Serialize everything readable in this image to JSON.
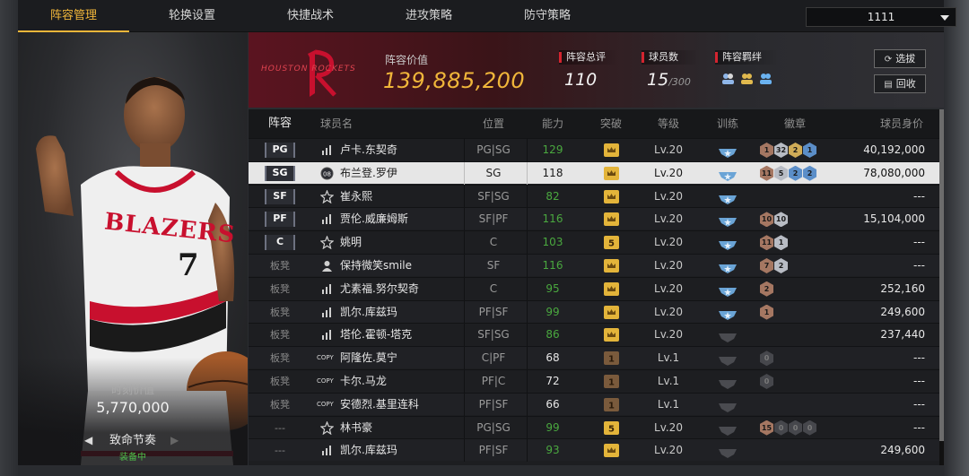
{
  "tabs": [
    {
      "label": "阵容管理",
      "active": true
    },
    {
      "label": "轮换设置",
      "active": false
    },
    {
      "label": "快捷战术",
      "active": false
    },
    {
      "label": "进攻策略",
      "active": false
    },
    {
      "label": "防守策略",
      "active": false
    }
  ],
  "team_select": {
    "value": "1111"
  },
  "card": {
    "value_label": "时刻价值",
    "value": "5,770,000",
    "skill": "致命节奏",
    "equipped": "装备中",
    "jersey_text": "BLAZERS",
    "jersey_number": "7"
  },
  "summary": {
    "logo_text": "HOUSTON ROCKETS",
    "value_label": "阵容价值",
    "value": "139,885,200",
    "rating_label": "阵容总评",
    "rating": "110",
    "count_label": "球员数",
    "count": "15",
    "count_max": "/300",
    "chem_label": "阵容羁绊",
    "select_btn": "选拔",
    "recycle_btn": "回收"
  },
  "columns": [
    "阵容",
    "球员名",
    "位置",
    "能力",
    "突破",
    "等级",
    "训练",
    "徽章",
    "球员身价"
  ],
  "rows": [
    {
      "slot": "PG",
      "name": "卢卡.东契奇",
      "icon": "bars",
      "pos": "PG|SG",
      "ability": "129",
      "green": true,
      "break": "crown",
      "level": "Lv.20",
      "train": "star",
      "badges": [
        [
          "b-bronze",
          "1"
        ],
        [
          "b-silver",
          "32"
        ],
        [
          "b-gold",
          "2"
        ],
        [
          "b-blue",
          "1"
        ]
      ],
      "value": "40,192,000"
    },
    {
      "slot": "SG",
      "name": "布兰登.罗伊",
      "icon": "badge",
      "pos": "SG",
      "ability": "118",
      "green": false,
      "break": "crown",
      "level": "Lv.20",
      "train": "star",
      "badges": [
        [
          "b-bronze",
          "11"
        ],
        [
          "b-silver",
          "5"
        ],
        [
          "b-blue",
          "2"
        ],
        [
          "b-blue",
          "2"
        ]
      ],
      "value": "78,080,000",
      "selected": true
    },
    {
      "slot": "SF",
      "name": "崔永熙",
      "icon": "star",
      "pos": "SF|SG",
      "ability": "82",
      "green": true,
      "break": "crown",
      "level": "Lv.20",
      "train": "star",
      "badges": [],
      "value": "---"
    },
    {
      "slot": "PF",
      "name": "贾伦.威廉姆斯",
      "icon": "bars",
      "pos": "SF|PF",
      "ability": "116",
      "green": true,
      "break": "crown",
      "level": "Lv.20",
      "train": "star",
      "badges": [
        [
          "b-bronze",
          "10"
        ],
        [
          "b-silver",
          "10"
        ]
      ],
      "value": "15,104,000"
    },
    {
      "slot": "C",
      "name": "姚明",
      "icon": "star",
      "pos": "C",
      "ability": "103",
      "green": true,
      "break": "five",
      "level": "Lv.20",
      "train": "star",
      "badges": [
        [
          "b-bronze",
          "11"
        ],
        [
          "b-silver",
          "1"
        ]
      ],
      "value": "---"
    },
    {
      "slot": "板凳",
      "name": "保持微笑smile",
      "icon": "person",
      "pos": "SF",
      "ability": "116",
      "green": true,
      "break": "crown",
      "level": "Lv.20",
      "train": "star",
      "badges": [
        [
          "b-bronze",
          "7"
        ],
        [
          "b-silver",
          "2"
        ]
      ],
      "value": "---"
    },
    {
      "slot": "板凳",
      "name": "尤素福.努尔契奇",
      "icon": "bars",
      "pos": "C",
      "ability": "95",
      "green": true,
      "break": "crown",
      "level": "Lv.20",
      "train": "star",
      "badges": [
        [
          "b-bronze",
          "2"
        ]
      ],
      "value": "252,160"
    },
    {
      "slot": "板凳",
      "name": "凯尔.库兹玛",
      "icon": "bars",
      "pos": "PF|SF",
      "ability": "99",
      "green": true,
      "break": "crown",
      "level": "Lv.20",
      "train": "star",
      "badges": [
        [
          "b-bronze",
          "1"
        ]
      ],
      "value": "249,600"
    },
    {
      "slot": "板凳",
      "name": "塔伦.霍顿-塔克",
      "icon": "bars",
      "pos": "SF|SG",
      "ability": "86",
      "green": true,
      "break": "crown",
      "level": "Lv.20",
      "train": "gray",
      "badges": [],
      "value": "237,440"
    },
    {
      "slot": "板凳",
      "name": "阿隆佐.莫宁",
      "icon": "copy",
      "pos": "C|PF",
      "ability": "68",
      "green": false,
      "break": "one",
      "level": "Lv.1",
      "train": "gray",
      "badges": [
        [
          "b-dark",
          "0"
        ]
      ],
      "value": "---"
    },
    {
      "slot": "板凳",
      "name": "卡尔.马龙",
      "icon": "copy",
      "pos": "PF|C",
      "ability": "72",
      "green": false,
      "break": "one",
      "level": "Lv.1",
      "train": "gray",
      "badges": [
        [
          "b-dark",
          "0"
        ]
      ],
      "value": "---"
    },
    {
      "slot": "板凳",
      "name": "安德烈.基里连科",
      "icon": "copy",
      "pos": "PF|SF",
      "ability": "66",
      "green": false,
      "break": "one",
      "level": "Lv.1",
      "train": "gray",
      "badges": [],
      "value": "---"
    },
    {
      "slot": "---",
      "name": "林书豪",
      "icon": "star",
      "pos": "PG|SG",
      "ability": "99",
      "green": true,
      "break": "five",
      "level": "Lv.20",
      "train": "gray",
      "badges": [
        [
          "b-bronze",
          "15"
        ],
        [
          "b-dark",
          "0"
        ],
        [
          "b-dark",
          "0"
        ],
        [
          "b-dark",
          "0"
        ]
      ],
      "value": "---"
    },
    {
      "slot": "---",
      "name": "凯尔.库兹玛",
      "icon": "bars",
      "pos": "PF|SF",
      "ability": "93",
      "green": true,
      "break": "crown",
      "level": "Lv.20",
      "train": "gray",
      "badges": [],
      "value": "249,600"
    }
  ],
  "copy_tag": "COPY",
  "colors": {
    "accent": "#f0b63a",
    "team_red": "#d3242f",
    "ability_green": "#4aa83f",
    "selected_row": "#e6e6e6"
  }
}
